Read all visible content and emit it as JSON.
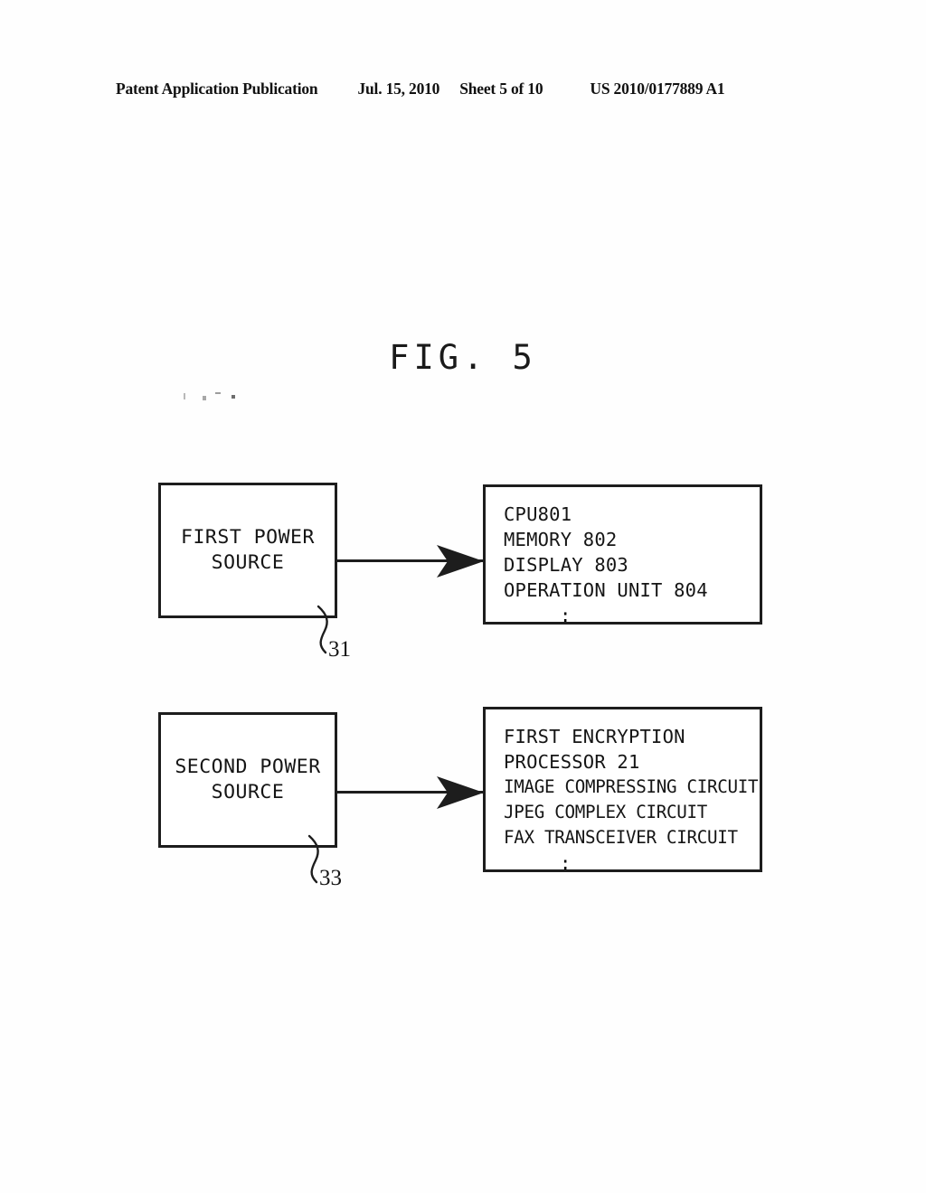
{
  "header": {
    "publication": "Patent Application Publication",
    "date": "Jul. 15, 2010",
    "sheet": "Sheet 5 of 10",
    "document_number": "US 2010/0177889 A1"
  },
  "figure": {
    "title": "FIG. 5",
    "colors": {
      "ink": "#1d1d1d",
      "paper": "#ffffff"
    },
    "blocks": [
      {
        "id": "first-power-source",
        "lines": [
          "FIRST POWER",
          "SOURCE"
        ],
        "ref": "31"
      },
      {
        "id": "first-load-group",
        "lines": [
          "CPU801",
          "MEMORY 802",
          "DISPLAY 803",
          "OPERATION UNIT 804"
        ],
        "continuation": ":"
      },
      {
        "id": "second-power-source",
        "lines": [
          "SECOND POWER",
          "SOURCE"
        ],
        "ref": "33"
      },
      {
        "id": "second-load-group",
        "lines": [
          "FIRST ENCRYPTION",
          "PROCESSOR 21",
          "IMAGE COMPRESSING CIRCUIT",
          "JPEG COMPLEX CIRCUIT",
          "FAX TRANSCEIVER CIRCUIT"
        ],
        "continuation": ":"
      }
    ],
    "connectors": [
      {
        "id": "arrow-first",
        "from": "first-power-source",
        "to": "first-load-group"
      },
      {
        "id": "arrow-second",
        "from": "second-power-source",
        "to": "second-load-group"
      }
    ]
  }
}
